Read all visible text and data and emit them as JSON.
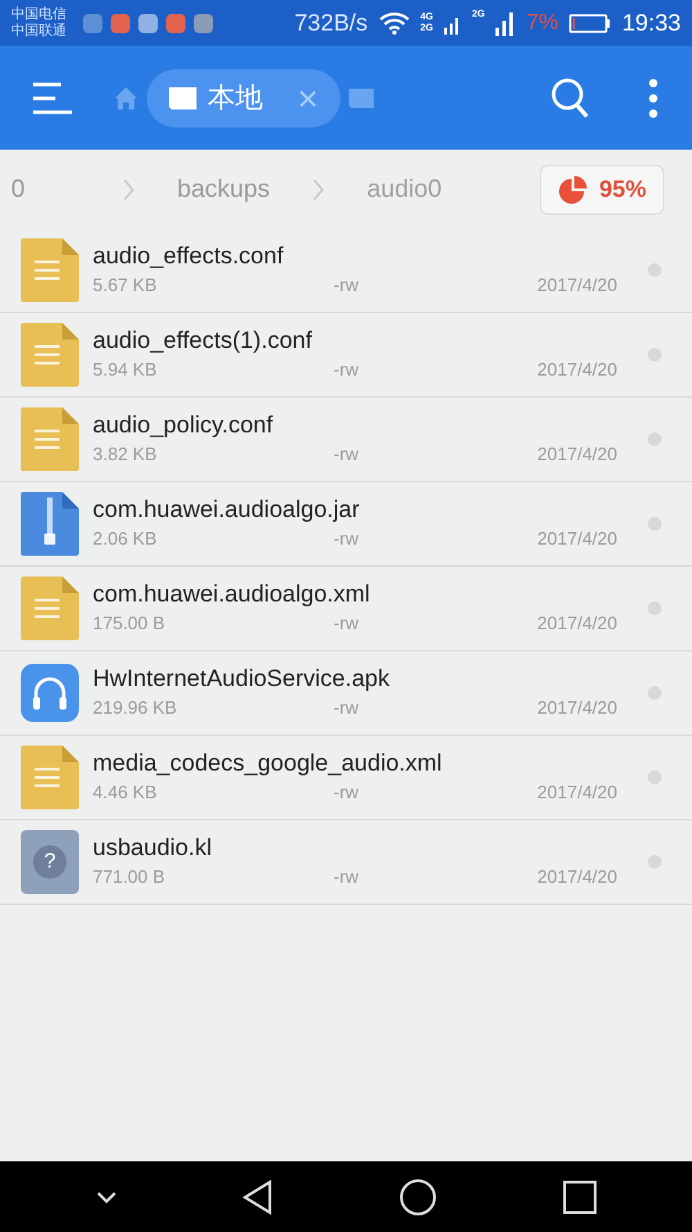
{
  "status_bar": {
    "carriers": [
      "中国电信",
      "中国联通"
    ],
    "speed": "732B/s",
    "network_labels": [
      "4G",
      "2G",
      "2G"
    ],
    "battery_percent": "7%",
    "time": "19:33"
  },
  "toolbar": {
    "tab": {
      "label": "本地",
      "close": "×"
    }
  },
  "breadcrumb": {
    "items": [
      "0",
      "backups",
      "audio0"
    ],
    "storage": "95%"
  },
  "files": [
    {
      "kind": "text",
      "name": "audio_effects.conf",
      "size": "5.67 KB",
      "permissions": "-rw",
      "date": "2017/4/20"
    },
    {
      "kind": "text",
      "name": "audio_effects(1).conf",
      "size": "5.94 KB",
      "permissions": "-rw",
      "date": "2017/4/20"
    },
    {
      "kind": "text",
      "name": "audio_policy.conf",
      "size": "3.82 KB",
      "permissions": "-rw",
      "date": "2017/4/20"
    },
    {
      "kind": "archive",
      "name": "com.huawei.audioalgo.jar",
      "size": "2.06 KB",
      "permissions": "-rw",
      "date": "2017/4/20"
    },
    {
      "kind": "text",
      "name": "com.huawei.audioalgo.xml",
      "size": "175.00 B",
      "permissions": "-rw",
      "date": "2017/4/20"
    },
    {
      "kind": "app",
      "name": "HwInternetAudioService.apk",
      "size": "219.96 KB",
      "permissions": "-rw",
      "date": "2017/4/20"
    },
    {
      "kind": "text",
      "name": "media_codecs_google_audio.xml",
      "size": "4.46 KB",
      "permissions": "-rw",
      "date": "2017/4/20"
    },
    {
      "kind": "unknown",
      "name": "usbaudio.kl",
      "size": "771.00 B",
      "permissions": "-rw",
      "date": "2017/4/20",
      "glyph": "?"
    }
  ]
}
